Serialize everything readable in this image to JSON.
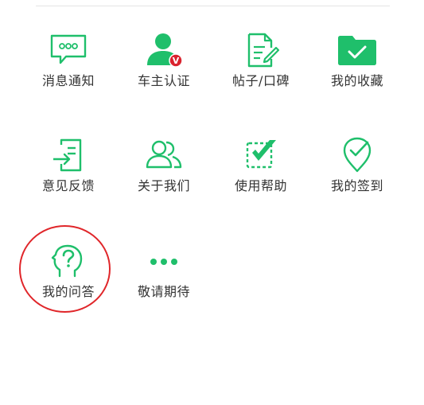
{
  "colors": {
    "accent": "#1fbf6b",
    "badge": "#d9232e",
    "annotation": "#e0262a",
    "text": "#333333"
  },
  "grid": {
    "items": [
      {
        "label": "消息通知",
        "icon": "message-bubble-icon"
      },
      {
        "label": "车主认证",
        "icon": "car-owner-verify-icon"
      },
      {
        "label": "帖子/口碑",
        "icon": "document-edit-icon"
      },
      {
        "label": "我的收藏",
        "icon": "folder-check-icon"
      },
      {
        "label": "意见反馈",
        "icon": "feedback-login-icon"
      },
      {
        "label": "关于我们",
        "icon": "users-icon"
      },
      {
        "label": "使用帮助",
        "icon": "help-checkbox-icon"
      },
      {
        "label": "我的签到",
        "icon": "checkin-pin-icon"
      },
      {
        "label": "我的问答",
        "icon": "question-head-icon"
      },
      {
        "label": "敬请期待",
        "icon": "more-dots-icon"
      }
    ]
  },
  "badge": {
    "text": "V"
  }
}
